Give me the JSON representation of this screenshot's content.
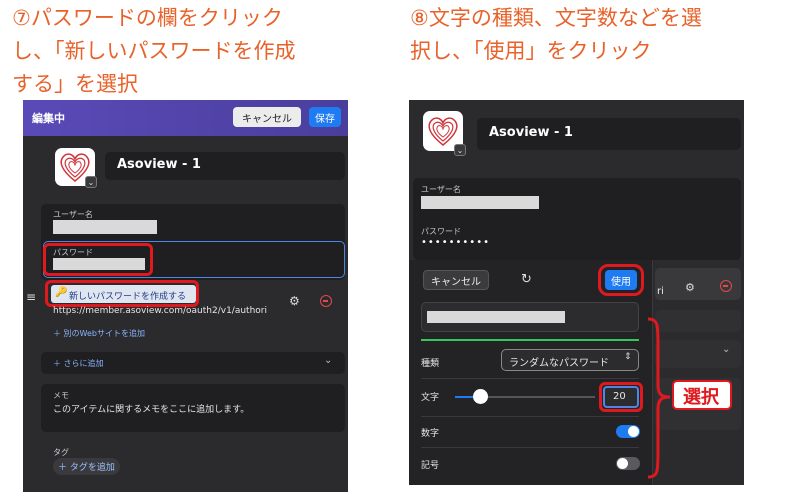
{
  "captions": {
    "left_line1": "⑦パスワードの欄をクリック",
    "left_line2": "し、「新しいパスワードを作成",
    "left_line3": "する」を選択",
    "right_line1": "⑧文字の種類、文字数などを選",
    "right_line2": "択し、「使用」をクリック"
  },
  "left_panel": {
    "header_title": "編集中",
    "cancel_label": "キャンセル",
    "save_label": "保存",
    "item_title": "Asoview - 1",
    "username_label": "ユーザー名",
    "password_label": "パスワード",
    "suggestion_label": "新しいパスワードを作成する",
    "url_text": "https://member.asoview.com/oauth2/v1/authori",
    "add_website_label": "＋ 別のWebサイトを追加",
    "add_more_label": "＋ さらに追加",
    "memo_label": "メモ",
    "memo_placeholder": "このアイテムに関するメモをここに追加します。",
    "tags_label": "タグ",
    "add_tag_label": "＋ タグを追加"
  },
  "right_panel": {
    "item_title": "Asoview - 1",
    "username_label": "ユーザー名",
    "password_label": "パスワード",
    "password_masked": "••••••••••",
    "cancel_label": "キャンセル",
    "use_label": "使用",
    "type_label": "種類",
    "type_value": "ランダムなパスワード",
    "chars_label": "文字",
    "chars_value": "20",
    "chars_fraction": 0.18,
    "digits_label": "数字",
    "digits_on": true,
    "symbols_label": "記号",
    "symbols_on": false,
    "partial_text": "ri",
    "annotation": "選択"
  },
  "colors": {
    "caption": "#e8622a",
    "highlight_red": "#e0191f",
    "accent_blue": "#1e7bf2",
    "panel_bg": "#2b2b2d"
  }
}
